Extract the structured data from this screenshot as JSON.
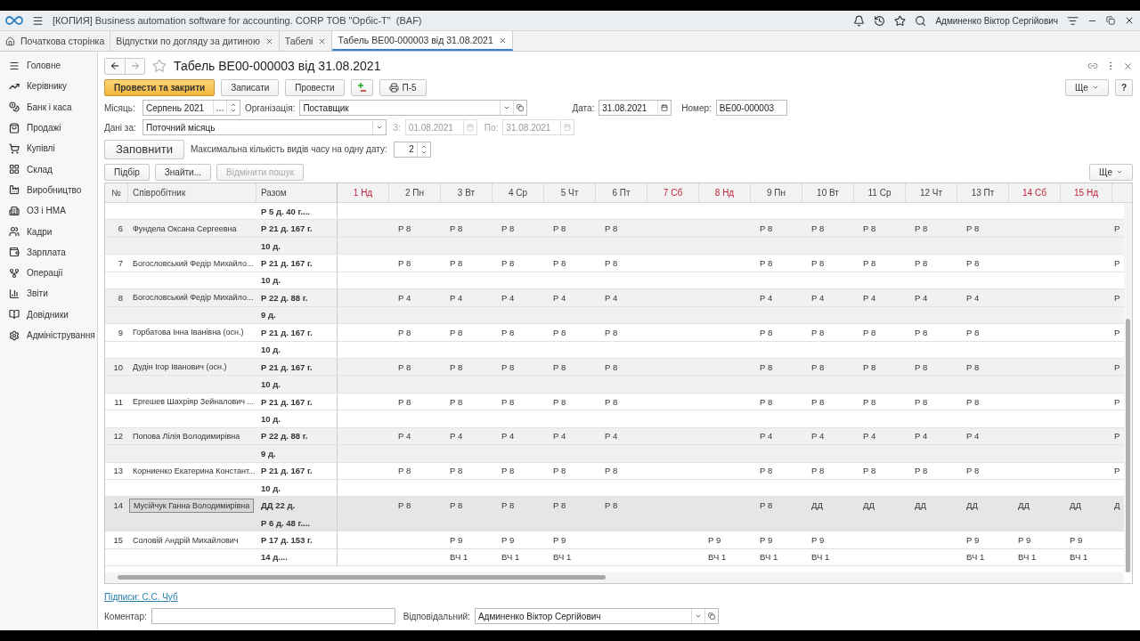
{
  "window": {
    "title": "[КОПИЯ] Business automation software for accounting. CORP ТОВ \"Орбіс-Т\"  (BAF)",
    "user": "Админенко Віктор Сергійович"
  },
  "tabs": [
    {
      "label": "Початкова сторінка",
      "kind": "home",
      "selected": false
    },
    {
      "label": "Відпустки по догляду за дитиною",
      "kind": "doc",
      "selected": false
    },
    {
      "label": "Табелі",
      "kind": "doc",
      "selected": false
    },
    {
      "label": "Табель BE00-000003 від 31.08.2021",
      "kind": "doc",
      "selected": true
    }
  ],
  "sidebar": {
    "items": [
      {
        "label": "Головне"
      },
      {
        "label": "Керівнику"
      },
      {
        "label": "Банк і каса"
      },
      {
        "label": "Продажі"
      },
      {
        "label": "Купівлі"
      },
      {
        "label": "Склад"
      },
      {
        "label": "Виробництво"
      },
      {
        "label": "ОЗ і НМА"
      },
      {
        "label": "Кадри"
      },
      {
        "label": "Зарплата"
      },
      {
        "label": "Операції"
      },
      {
        "label": "Звіти"
      },
      {
        "label": "Довідники"
      },
      {
        "label": "Адміністрування"
      }
    ]
  },
  "document": {
    "title": "Табель BE00-000003 від 31.08.2021",
    "toolbar": [
      {
        "label": "Провести та закрити",
        "kind": "primary"
      },
      {
        "label": "Записати",
        "kind": "plain"
      },
      {
        "label": "Провести",
        "kind": "plain"
      },
      {
        "kind": "dtkt"
      },
      {
        "label": "П-5",
        "kind": "print"
      }
    ],
    "more": "Ще",
    "help": "?",
    "fields": {
      "month_label": "Місяць:",
      "month": "Серпень 2021",
      "org_label": "Організація:",
      "org": "Поставщик",
      "date_label": "Дата:",
      "date": "31.08.2021",
      "number_label": "Номер:",
      "number": "BE00-000003",
      "period_label": "Дані за:",
      "period": "Поточний місяць",
      "from_label": "З:",
      "from": "01.08.2021",
      "to_label": "По:",
      "to": "31.08.2021"
    },
    "fill_button": "Заповнити",
    "max_label": "Максимальна кількість видів часу на одну дату:",
    "max_value": "2",
    "table_buttons": [
      {
        "label": "Підбір",
        "disabled": false
      },
      {
        "label": "Знайти...",
        "disabled": false
      },
      {
        "label": "Відмінити пошук",
        "disabled": true
      }
    ],
    "table_more": "Ще",
    "table": {
      "columns": [
        "№",
        "Співробітник",
        "Разом"
      ],
      "days": [
        {
          "label": "1 Нд",
          "weekend": true
        },
        {
          "label": "2 Пн",
          "weekend": false
        },
        {
          "label": "3 Вт",
          "weekend": false
        },
        {
          "label": "4 Ср",
          "weekend": false
        },
        {
          "label": "5 Чт",
          "weekend": false
        },
        {
          "label": "6 Пт",
          "weekend": false
        },
        {
          "label": "7 Сб",
          "weekend": true
        },
        {
          "label": "8 Нд",
          "weekend": true
        },
        {
          "label": "9 Пн",
          "weekend": false
        },
        {
          "label": "10 Вт",
          "weekend": false
        },
        {
          "label": "11 Ср",
          "weekend": false
        },
        {
          "label": "12 Чт",
          "weekend": false
        },
        {
          "label": "13 Пт",
          "weekend": false
        },
        {
          "label": "14 Сб",
          "weekend": true
        },
        {
          "label": "15 Нд",
          "weekend": true
        }
      ],
      "rows": [
        {
          "total_2": "Р 5 д. 40 г....",
          "selected": false
        },
        {
          "number": "6",
          "name": "Фундела Оксана Сергеевна",
          "total": "Р 21 д. 167 г.",
          "total_2": "10 д.",
          "selected": false,
          "days": [
            {
              "kind": "blank"
            },
            {
              "kind": "value",
              "text": "Р 8"
            },
            {
              "kind": "value",
              "text": "Р 8"
            },
            {
              "kind": "value",
              "text": "Р 8"
            },
            {
              "kind": "value",
              "text": "Р 8"
            },
            {
              "kind": "value",
              "text": "Р 8"
            },
            {
              "kind": "blank"
            },
            {
              "kind": "blank"
            },
            {
              "kind": "value",
              "text": "Р 8"
            },
            {
              "kind": "value",
              "text": "Р 8"
            },
            {
              "kind": "value",
              "text": "Р 8"
            },
            {
              "kind": "value",
              "text": "Р 8"
            },
            {
              "kind": "value",
              "text": "Р 8"
            },
            {
              "kind": "blank"
            },
            {
              "kind": "blank"
            },
            {
              "kind": "value",
              "text": "Р"
            }
          ]
        },
        {
          "number": "7",
          "name": "Богословський Федір Михайло...",
          "total": "Р 21 д. 167 г.",
          "total_2": "10 д.",
          "selected": false,
          "days": [
            {
              "kind": "blank"
            },
            {
              "kind": "value",
              "text": "Р 8"
            },
            {
              "kind": "value",
              "text": "Р 8"
            },
            {
              "kind": "value",
              "text": "Р 8"
            },
            {
              "kind": "value",
              "text": "Р 8"
            },
            {
              "kind": "value",
              "text": "Р 8"
            },
            {
              "kind": "blank"
            },
            {
              "kind": "blank"
            },
            {
              "kind": "value",
              "text": "Р 8"
            },
            {
              "kind": "value",
              "text": "Р 8"
            },
            {
              "kind": "value",
              "text": "Р 8"
            },
            {
              "kind": "value",
              "text": "Р 8"
            },
            {
              "kind": "value",
              "text": "Р 8"
            },
            {
              "kind": "blank"
            },
            {
              "kind": "blank"
            },
            {
              "kind": "value",
              "text": "Р"
            }
          ]
        },
        {
          "number": "8",
          "name": "Богословський Федір Михайло...",
          "total": "Р 22 д. 88 г.",
          "total_2": "9 д.",
          "selected": false,
          "days": [
            {
              "kind": "blank"
            },
            {
              "kind": "value",
              "text": "Р 4"
            },
            {
              "kind": "value",
              "text": "Р 4"
            },
            {
              "kind": "value",
              "text": "Р 4"
            },
            {
              "kind": "value",
              "text": "Р 4"
            },
            {
              "kind": "value",
              "text": "Р 4"
            },
            {
              "kind": "blank"
            },
            {
              "kind": "blank"
            },
            {
              "kind": "value",
              "text": "Р 4"
            },
            {
              "kind": "value",
              "text": "Р 4"
            },
            {
              "kind": "value",
              "text": "Р 4"
            },
            {
              "kind": "value",
              "text": "Р 4"
            },
            {
              "kind": "value",
              "text": "Р 4"
            },
            {
              "kind": "blank"
            },
            {
              "kind": "blank"
            },
            {
              "kind": "value",
              "text": "Р"
            }
          ]
        },
        {
          "number": "9",
          "name": "Горбатова Інна Іванівна (осн.)",
          "total": "Р 21 д. 167 г.",
          "total_2": "10 д.",
          "selected": false,
          "days": [
            {
              "kind": "blank"
            },
            {
              "kind": "value",
              "text": "Р 8"
            },
            {
              "kind": "value",
              "text": "Р 8"
            },
            {
              "kind": "value",
              "text": "Р 8"
            },
            {
              "kind": "value",
              "text": "Р 8"
            },
            {
              "kind": "value",
              "text": "Р 8"
            },
            {
              "kind": "blank"
            },
            {
              "kind": "blank"
            },
            {
              "kind": "value",
              "text": "Р 8"
            },
            {
              "kind": "value",
              "text": "Р 8"
            },
            {
              "kind": "value",
              "text": "Р 8"
            },
            {
              "kind": "value",
              "text": "Р 8"
            },
            {
              "kind": "value",
              "text": "Р 8"
            },
            {
              "kind": "blank"
            },
            {
              "kind": "blank"
            },
            {
              "kind": "value",
              "text": "Р"
            }
          ]
        },
        {
          "number": "10",
          "name": "Дудін Ігор Іванович (осн.)",
          "total": "Р 21 д. 167 г.",
          "total_2": "10 д.",
          "selected": false,
          "days": [
            {
              "kind": "blank"
            },
            {
              "kind": "value",
              "text": "Р 8"
            },
            {
              "kind": "value",
              "text": "Р 8"
            },
            {
              "kind": "value",
              "text": "Р 8"
            },
            {
              "kind": "value",
              "text": "Р 8"
            },
            {
              "kind": "value",
              "text": "Р 8"
            },
            {
              "kind": "blank"
            },
            {
              "kind": "blank"
            },
            {
              "kind": "value",
              "text": "Р 8"
            },
            {
              "kind": "value",
              "text": "Р 8"
            },
            {
              "kind": "value",
              "text": "Р 8"
            },
            {
              "kind": "value",
              "text": "Р 8"
            },
            {
              "kind": "value",
              "text": "Р 8"
            },
            {
              "kind": "blank"
            },
            {
              "kind": "blank"
            },
            {
              "kind": "value",
              "text": "Р"
            }
          ]
        },
        {
          "number": "11",
          "name": "Ергешев Шахріяр Зейналович ...",
          "total": "Р 21 д. 167 г.",
          "total_2": "10 д.",
          "selected": false,
          "days": [
            {
              "kind": "blank"
            },
            {
              "kind": "value",
              "text": "Р 8"
            },
            {
              "kind": "value",
              "text": "Р 8"
            },
            {
              "kind": "value",
              "text": "Р 8"
            },
            {
              "kind": "value",
              "text": "Р 8"
            },
            {
              "kind": "value",
              "text": "Р 8"
            },
            {
              "kind": "blank"
            },
            {
              "kind": "blank"
            },
            {
              "kind": "value",
              "text": "Р 8"
            },
            {
              "kind": "value",
              "text": "Р 8"
            },
            {
              "kind": "value",
              "text": "Р 8"
            },
            {
              "kind": "value",
              "text": "Р 8"
            },
            {
              "kind": "value",
              "text": "Р 8"
            },
            {
              "kind": "blank"
            },
            {
              "kind": "blank"
            },
            {
              "kind": "value",
              "text": "Р"
            }
          ]
        },
        {
          "number": "12",
          "name": "Попова Лілія Володимирівна",
          "total": "Р 22 д. 88 г.",
          "total_2": "9 д.",
          "selected": false,
          "days": [
            {
              "kind": "blank"
            },
            {
              "kind": "value",
              "text": "Р 4"
            },
            {
              "kind": "value",
              "text": "Р 4"
            },
            {
              "kind": "value",
              "text": "Р 4"
            },
            {
              "kind": "value",
              "text": "Р 4"
            },
            {
              "kind": "value",
              "text": "Р 4"
            },
            {
              "kind": "blank"
            },
            {
              "kind": "blank"
            },
            {
              "kind": "value",
              "text": "Р 4"
            },
            {
              "kind": "value",
              "text": "Р 4"
            },
            {
              "kind": "value",
              "text": "Р 4"
            },
            {
              "kind": "value",
              "text": "Р 4"
            },
            {
              "kind": "value",
              "text": "Р 4"
            },
            {
              "kind": "blank"
            },
            {
              "kind": "blank"
            },
            {
              "kind": "value",
              "text": "Р"
            }
          ]
        },
        {
          "number": "13",
          "name": "Корниенко Екатерина Констант...",
          "total": "Р 21 д. 167 г.",
          "total_2": "10 д.",
          "selected": false,
          "days": [
            {
              "kind": "blank"
            },
            {
              "kind": "value",
              "text": "Р 8"
            },
            {
              "kind": "value",
              "text": "Р 8"
            },
            {
              "kind": "value",
              "text": "Р 8"
            },
            {
              "kind": "value",
              "text": "Р 8"
            },
            {
              "kind": "value",
              "text": "Р 8"
            },
            {
              "kind": "blank"
            },
            {
              "kind": "blank"
            },
            {
              "kind": "value",
              "text": "Р 8"
            },
            {
              "kind": "value",
              "text": "Р 8"
            },
            {
              "kind": "value",
              "text": "Р 8"
            },
            {
              "kind": "value",
              "text": "Р 8"
            },
            {
              "kind": "value",
              "text": "Р 8"
            },
            {
              "kind": "blank"
            },
            {
              "kind": "blank"
            },
            {
              "kind": "value",
              "text": "Р"
            }
          ]
        },
        {
          "number": "14",
          "name": "Мусійчук Ганна Володимирівна",
          "total": "ДД 22 д.",
          "total_2": "Р 6 д. 48 г....",
          "selected": true,
          "days": [
            {
              "kind": "blank"
            },
            {
              "kind": "value",
              "text": "Р 8"
            },
            {
              "kind": "value",
              "text": "Р 8"
            },
            {
              "kind": "value",
              "text": "Р 8"
            },
            {
              "kind": "value",
              "text": "Р 8"
            },
            {
              "kind": "value",
              "text": "Р 8"
            },
            {
              "kind": "blank"
            },
            {
              "kind": "blank"
            },
            {
              "kind": "value",
              "text": "Р 8"
            },
            {
              "kind": "value",
              "text": "ДД"
            },
            {
              "kind": "value",
              "text": "ДД"
            },
            {
              "kind": "value",
              "text": "ДД"
            },
            {
              "kind": "value",
              "text": "ДД"
            },
            {
              "kind": "value",
              "text": "ДД"
            },
            {
              "kind": "value",
              "text": "ДД"
            },
            {
              "kind": "value",
              "text": "Д"
            }
          ]
        },
        {
          "number": "15",
          "name": "Соловій Андрій Михайлович",
          "total": "Р 17 д. 153 г.",
          "total_2": "14 д....",
          "selected": false,
          "days": [
            {
              "kind": "blank"
            },
            {
              "kind": "blank"
            },
            {
              "kind": "value",
              "text": "Р 9"
            },
            {
              "kind": "value",
              "text": "Р 9"
            },
            {
              "kind": "value",
              "text": "Р 9"
            },
            {
              "kind": "blank"
            },
            {
              "kind": "blank"
            },
            {
              "kind": "value",
              "text": "Р 9"
            },
            {
              "kind": "value",
              "text": "Р 9"
            },
            {
              "kind": "value",
              "text": "Р 9"
            },
            {
              "kind": "blank"
            },
            {
              "kind": "blank"
            },
            {
              "kind": "value",
              "text": "Р 9"
            },
            {
              "kind": "value",
              "text": "Р 9"
            },
            {
              "kind": "value",
              "text": "Р 9"
            }
          ],
          "days_2": [
            {
              "kind": "blank"
            },
            {
              "kind": "blank"
            },
            {
              "kind": "value",
              "text": "ВЧ 1"
            },
            {
              "kind": "value",
              "text": "ВЧ 1"
            },
            {
              "kind": "value",
              "text": "ВЧ 1"
            },
            {
              "kind": "blank"
            },
            {
              "kind": "blank"
            },
            {
              "kind": "value",
              "text": "ВЧ 1"
            },
            {
              "kind": "value",
              "text": "ВЧ 1"
            },
            {
              "kind": "value",
              "text": "ВЧ 1"
            },
            {
              "kind": "blank"
            },
            {
              "kind": "blank"
            },
            {
              "kind": "value",
              "text": "ВЧ 1"
            },
            {
              "kind": "value",
              "text": "ВЧ 1"
            },
            {
              "kind": "value",
              "text": "ВЧ 1"
            }
          ]
        }
      ]
    },
    "signatures": "Підписи: С.С. Чуб",
    "comment_label": "Коментар:",
    "responsible_label": "Відповідальний:",
    "responsible": "Админенко Віктор Сергійович"
  }
}
